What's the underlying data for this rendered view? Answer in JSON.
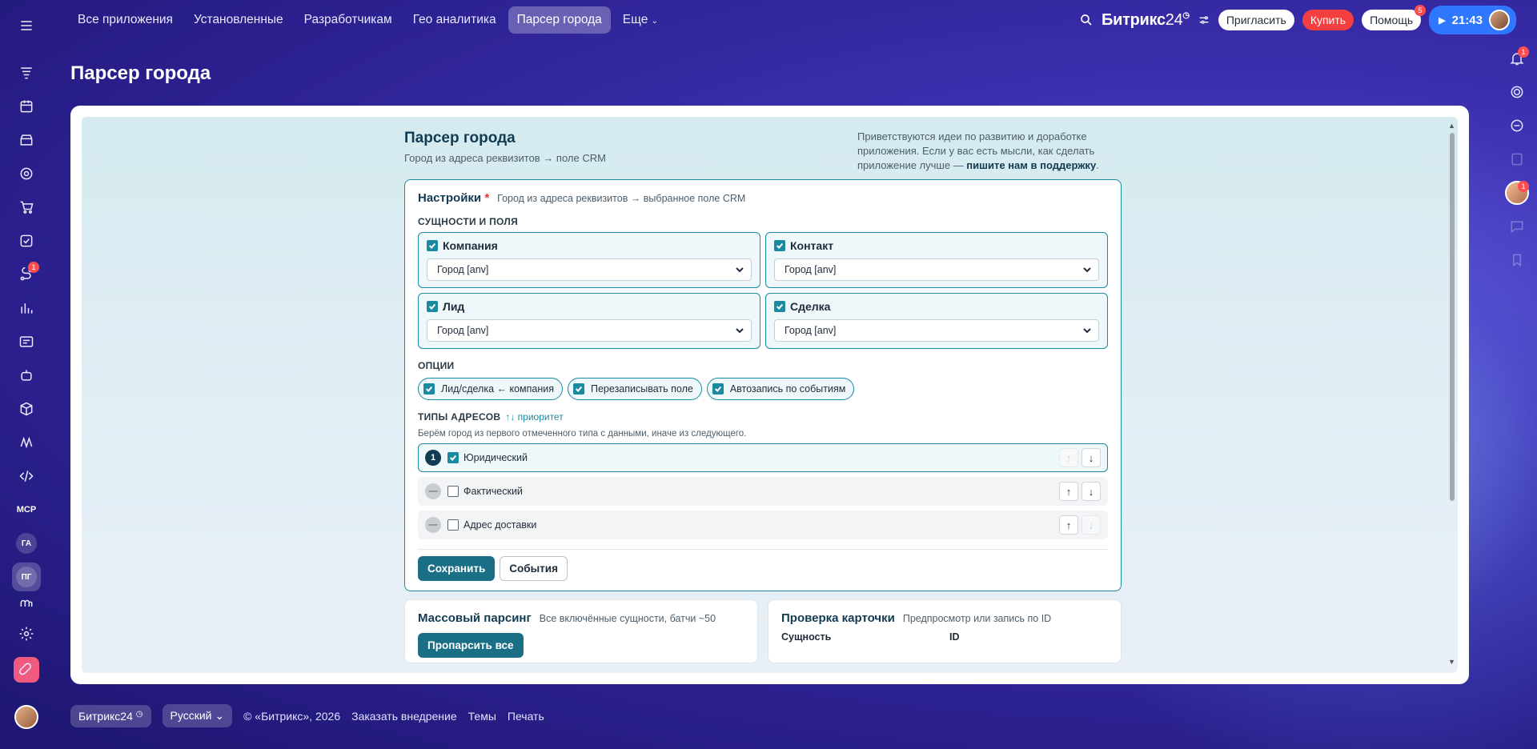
{
  "top_nav": {
    "items": [
      {
        "label": "Все приложения",
        "active": false
      },
      {
        "label": "Установленные",
        "active": false
      },
      {
        "label": "Разработчикам",
        "active": false
      },
      {
        "label": "Гео аналитика",
        "active": false
      },
      {
        "label": "Парсер города",
        "active": true
      },
      {
        "label": "Еще",
        "active": false
      }
    ]
  },
  "header": {
    "brand": "Битрикс",
    "brand_num": "24",
    "invite_label": "Пригласить",
    "buy_label": "Купить",
    "help_label": "Помощь",
    "help_badge": "5",
    "clock": "21:43"
  },
  "left_sidebar": {
    "icons": [
      "menu-icon",
      "feed-icon",
      "calendar-icon",
      "store-icon",
      "target-icon",
      "cart-icon",
      "tasks-icon",
      "automation-icon",
      "analytics-icon",
      "contact-center-icon",
      "robot-icon",
      "box-icon",
      "sign-icon",
      "code-icon"
    ],
    "automation_badge": "1",
    "mcp_label": "MCP",
    "ga_label": "ГА",
    "pg_label": "ПГ"
  },
  "right_sidebar": {
    "notification_badge": "1",
    "avatar_badge": "1"
  },
  "page": {
    "title": "Парсер города"
  },
  "app": {
    "title": "Парсер города",
    "subtitle": "Город из адреса реквизитов → поле CRM",
    "note_text": "Приветствуются идеи по развитию и доработке приложения. Если у вас есть мысли, как сделать приложение лучше — ",
    "note_link": "пишите нам в поддержку",
    "note_end": ".",
    "settings": {
      "title": "Настройки",
      "required_mark": "*",
      "subtitle": "Город из адреса реквизитов → выбранное поле CRM",
      "entities_section": "СУЩНОСТИ И ПОЛЯ",
      "entities": [
        {
          "label": "Компания",
          "value": "Город [anv]"
        },
        {
          "label": "Контакт",
          "value": "Город [anv]"
        },
        {
          "label": "Лид",
          "value": "Город [anv]"
        },
        {
          "label": "Сделка",
          "value": "Город [anv]"
        }
      ],
      "options_section": "ОПЦИИ",
      "options": [
        {
          "label": "Лид/сделка ← компания"
        },
        {
          "label": "Перезаписывать поле"
        },
        {
          "label": "Автозапись по событиям"
        }
      ],
      "addr_section": "ТИПЫ АДРЕСОВ",
      "addr_priority": "↑↓ приоритет",
      "addr_hint": "Берём город из первого отмеченного типа с данными, иначе из следующего.",
      "addresses": [
        {
          "num": "1",
          "label": "Юридический",
          "checked": true
        },
        {
          "num": "—",
          "label": "Фактический",
          "checked": false
        },
        {
          "num": "—",
          "label": "Адрес доставки",
          "checked": false
        }
      ],
      "save_label": "Сохранить",
      "events_label": "События"
    },
    "mass": {
      "title": "Массовый парсинг",
      "subtitle": "Все включённые сущности, батчи ~50",
      "button": "Пропарсить все"
    },
    "check": {
      "title": "Проверка карточки",
      "subtitle": "Предпросмотр или запись по ID",
      "entity_label": "Сущность",
      "id_label": "ID"
    }
  },
  "footer": {
    "brand": "Битрикс24",
    "language": "Русский",
    "copyright": "© «Битрикс», 2026",
    "order": "Заказать внедрение",
    "themes": "Темы",
    "print": "Печать"
  }
}
